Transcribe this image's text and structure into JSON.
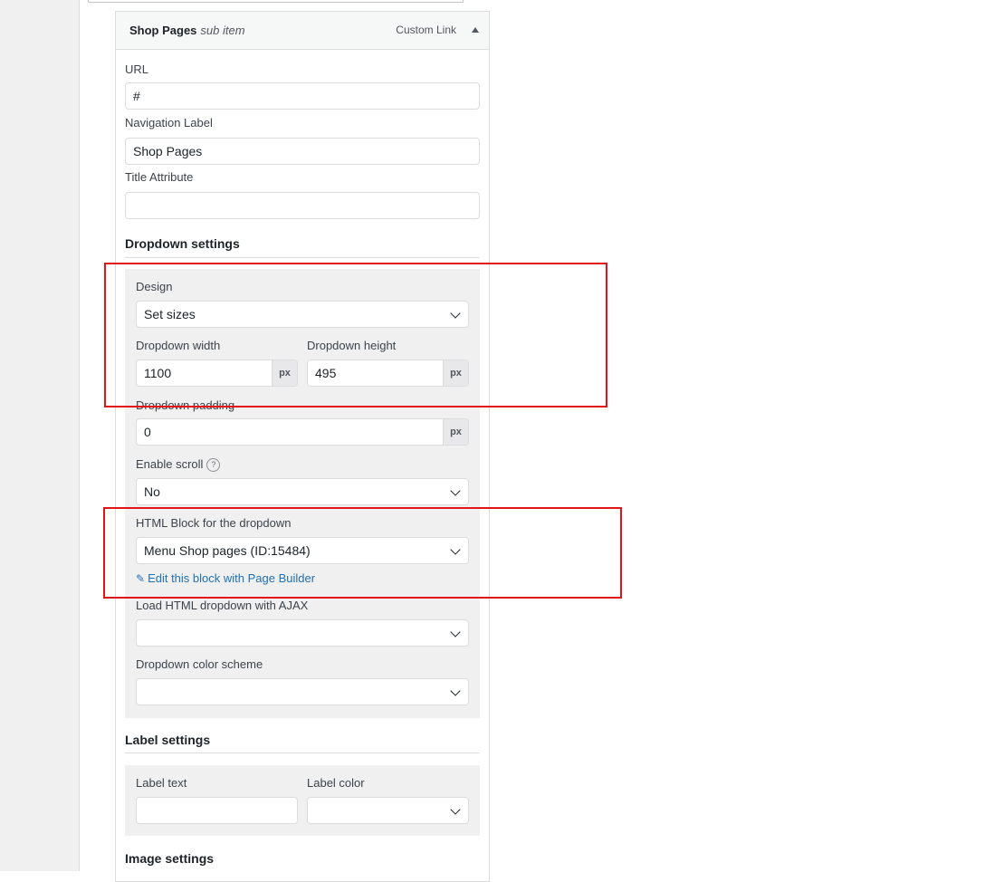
{
  "menu_item": {
    "title": "Shop Pages",
    "subtitle": "sub item",
    "type": "Custom Link"
  },
  "fields": {
    "url": {
      "label": "URL",
      "value": "#"
    },
    "nav_label": {
      "label": "Navigation Label",
      "value": "Shop Pages"
    },
    "title_attr": {
      "label": "Title Attribute",
      "value": ""
    }
  },
  "dropdown_settings": {
    "heading": "Dropdown settings",
    "design": {
      "label": "Design",
      "value": "Set sizes"
    },
    "width": {
      "label": "Dropdown width",
      "value": "1100",
      "unit": "px"
    },
    "height": {
      "label": "Dropdown height",
      "value": "495",
      "unit": "px"
    },
    "padding": {
      "label": "Dropdown padding",
      "value": "0",
      "unit": "px"
    },
    "scroll": {
      "label": "Enable scroll",
      "help": "?",
      "value": "No"
    },
    "html_block": {
      "label": "HTML Block for the dropdown",
      "value": "Menu Shop pages (ID:15484)"
    },
    "edit_link": "Edit this block with Page Builder",
    "ajax": {
      "label": "Load HTML dropdown with AJAX",
      "value": ""
    },
    "color_scheme": {
      "label": "Dropdown color scheme",
      "value": ""
    }
  },
  "label_settings": {
    "heading": "Label settings",
    "text": {
      "label": "Label text",
      "value": ""
    },
    "color": {
      "label": "Label color",
      "value": ""
    }
  },
  "image_settings": {
    "heading": "Image settings"
  },
  "colors": {
    "highlight": "#e01515",
    "link": "#2271b1",
    "panel": "#f0f0f1"
  }
}
